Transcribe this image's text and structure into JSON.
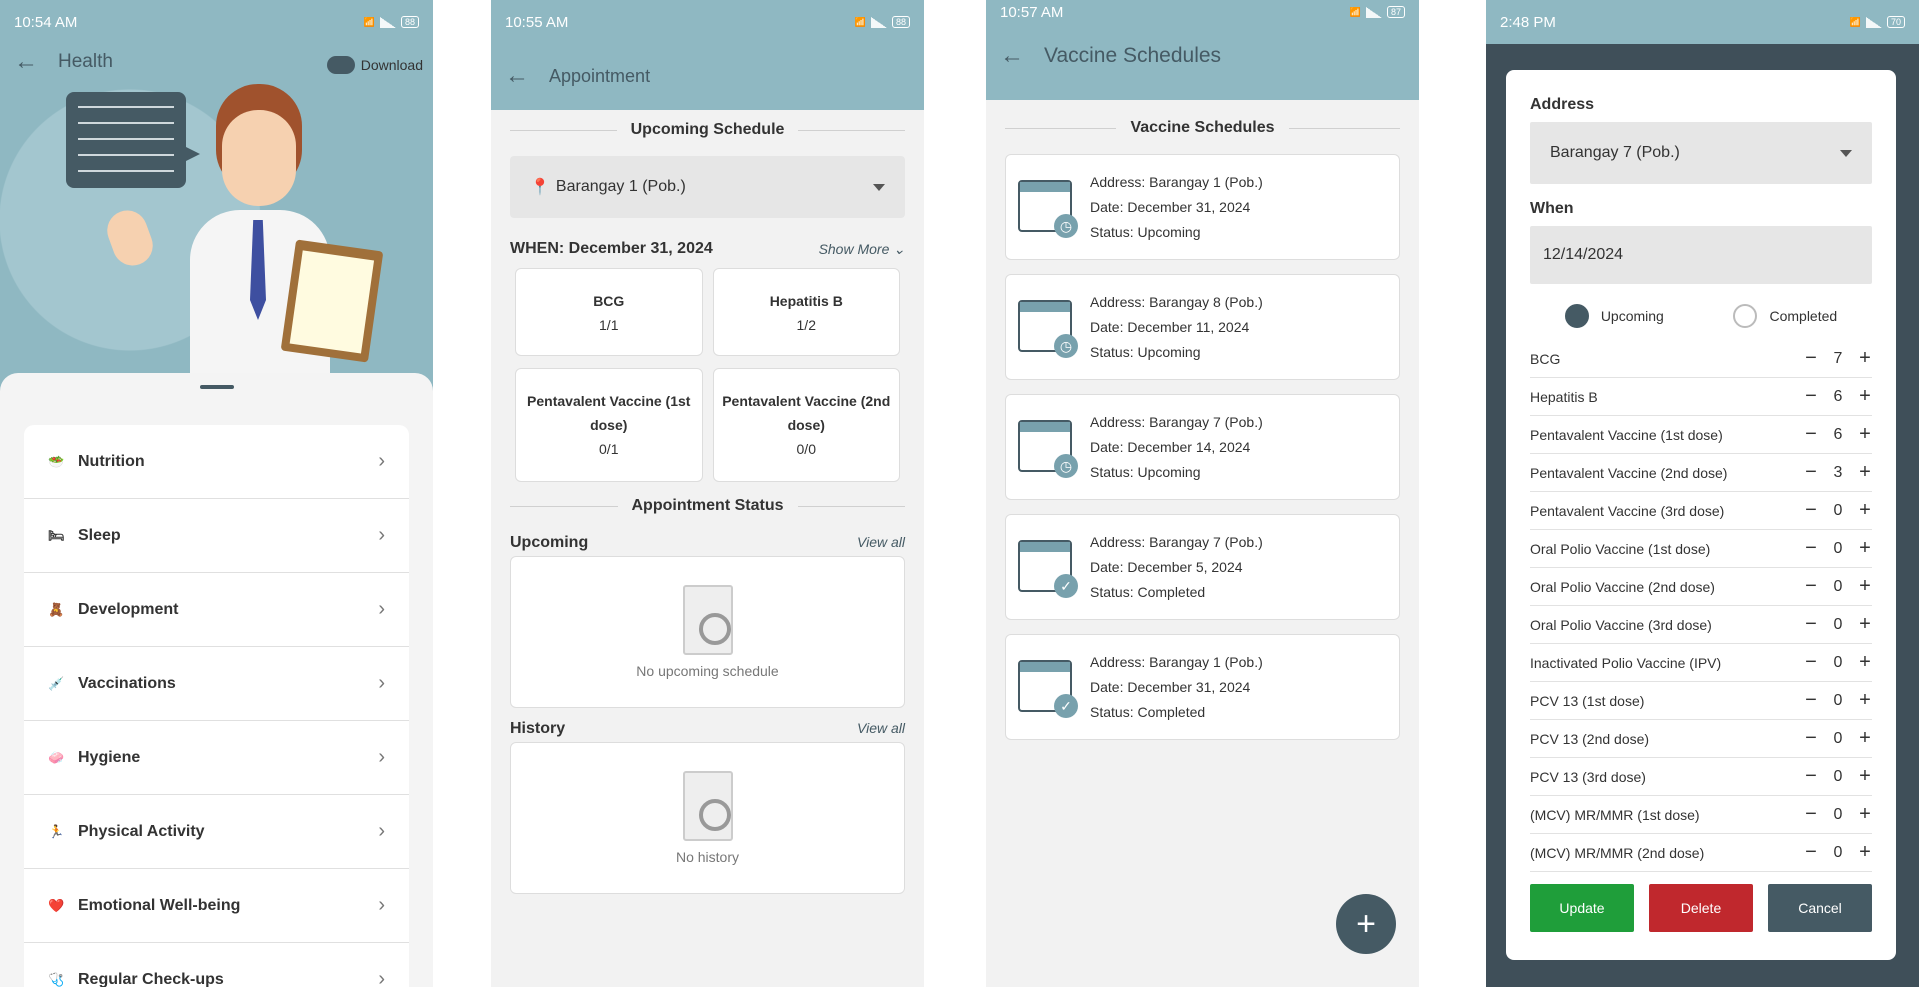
{
  "screen1": {
    "time": "10:54 AM",
    "status_right": "88",
    "title": "Health",
    "download_label": "Download",
    "menu": [
      {
        "icon": "🥗",
        "label": "Nutrition"
      },
      {
        "icon": "🛏",
        "label": "Sleep"
      },
      {
        "icon": "🧸",
        "label": "Development"
      },
      {
        "icon": "💉",
        "label": "Vaccinations"
      },
      {
        "icon": "🧼",
        "label": "Hygiene"
      },
      {
        "icon": "🏃",
        "label": "Physical Activity"
      },
      {
        "icon": "❤️",
        "label": "Emotional Well-being"
      },
      {
        "icon": "🩺",
        "label": "Regular Check-ups"
      }
    ]
  },
  "screen2": {
    "time": "10:55 AM",
    "status_right": "88",
    "title": "Appointment",
    "upcoming_schedule": "Upcoming Schedule",
    "location": "Barangay 1 (Pob.)",
    "when": "WHEN: December 31, 2024",
    "show_more": "Show More",
    "vaccines": [
      {
        "name": "BCG",
        "count": "1/1"
      },
      {
        "name": "Hepatitis B",
        "count": "1/2"
      },
      {
        "name": "Pentavalent Vaccine (1st dose)",
        "count": "0/1"
      },
      {
        "name": "Pentavalent Vaccine (2nd dose)",
        "count": "0/0"
      }
    ],
    "appointment_status": "Appointment Status",
    "upcoming_label": "Upcoming",
    "history_label": "History",
    "view_all": "View all",
    "no_upcoming": "No upcoming schedule",
    "no_history": "No history"
  },
  "screen3": {
    "time": "10:57 AM",
    "status_right": "87",
    "title": "Vaccine Schedules",
    "section_title": "Vaccine Schedules",
    "schedules": [
      {
        "address": "Address: Barangay 1 (Pob.)",
        "date": "Date: December 31, 2024",
        "status": "Status: Upcoming",
        "badge": "clock"
      },
      {
        "address": "Address: Barangay 8 (Pob.)",
        "date": "Date: December 11, 2024",
        "status": "Status: Upcoming",
        "badge": "clock"
      },
      {
        "address": "Address: Barangay 7 (Pob.)",
        "date": "Date: December 14, 2024",
        "status": "Status: Upcoming",
        "badge": "clock"
      },
      {
        "address": "Address: Barangay 7 (Pob.)",
        "date": "Date: December 5, 2024",
        "status": "Status: Completed",
        "badge": "check"
      },
      {
        "address": "Address: Barangay 1 (Pob.)",
        "date": "Date: December 31, 2024",
        "status": "Status: Completed",
        "badge": "check"
      }
    ],
    "fab_label": "+"
  },
  "screen4": {
    "time": "2:48 PM",
    "status_right": "70",
    "address_label": "Address",
    "address_value": "Barangay 7 (Pob.)",
    "when_label": "When",
    "when_value": "12/14/2024",
    "radio_upcoming": "Upcoming",
    "radio_completed": "Completed",
    "selected_status": "Upcoming",
    "vaccine_counts": [
      {
        "name": "BCG",
        "value": "7"
      },
      {
        "name": "Hepatitis B",
        "value": "6"
      },
      {
        "name": "Pentavalent Vaccine (1st dose)",
        "value": "6"
      },
      {
        "name": "Pentavalent Vaccine (2nd dose)",
        "value": "3"
      },
      {
        "name": "Pentavalent Vaccine (3rd dose)",
        "value": "0"
      },
      {
        "name": "Oral Polio Vaccine (1st dose)",
        "value": "0"
      },
      {
        "name": "Oral Polio Vaccine (2nd dose)",
        "value": "0"
      },
      {
        "name": "Oral Polio Vaccine (3rd dose)",
        "value": "0"
      },
      {
        "name": "Inactivated Polio Vaccine (IPV)",
        "value": "0"
      },
      {
        "name": "PCV 13 (1st dose)",
        "value": "0"
      },
      {
        "name": "PCV 13 (2nd dose)",
        "value": "0"
      },
      {
        "name": "PCV 13 (3rd dose)",
        "value": "0"
      },
      {
        "name": "(MCV) MR/MMR (1st dose)",
        "value": "0"
      },
      {
        "name": "(MCV) MR/MMR (2nd dose)",
        "value": "0"
      }
    ],
    "buttons": {
      "update": "Update",
      "delete": "Delete",
      "cancel": "Cancel"
    }
  },
  "colors": {
    "teal": "#8fb8c2",
    "dark_slate": "#455a64",
    "green": "#1f9e3a",
    "red": "#c0282d"
  }
}
